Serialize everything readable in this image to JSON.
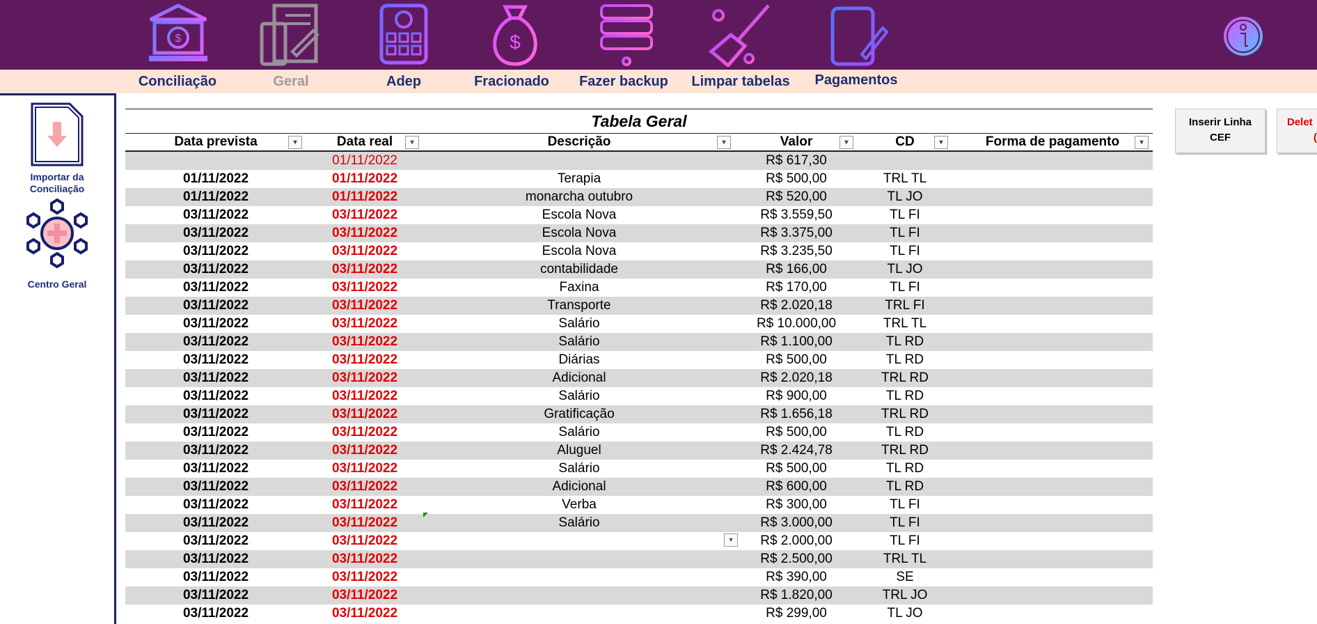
{
  "nav": [
    {
      "label": "Conciliação",
      "icon": "bank-icon"
    },
    {
      "label": "Geral",
      "icon": "calculator-document-icon"
    },
    {
      "label": "Adep",
      "icon": "bitcoin-calculator-icon"
    },
    {
      "label": "Fracionado",
      "icon": "money-bag-icon"
    },
    {
      "label": "Fazer backup",
      "icon": "server-backup-icon"
    },
    {
      "label": "Limpar tabelas",
      "icon": "broom-icon"
    },
    {
      "label": "Pagamentos",
      "icon": "edit-document-icon"
    }
  ],
  "sidebar": {
    "import_label_1": "Importar da",
    "import_label_2": "Conciliação",
    "center_label": "Centro Geral"
  },
  "table": {
    "title": "Tabela Geral",
    "columns": [
      "Data prevista",
      "Data real",
      "Descrição",
      "Valor",
      "CD",
      "Forma de pagamento"
    ],
    "rows": [
      {
        "dp": "",
        "dr": "01/11/2022",
        "desc": "",
        "valor": "R$ 617,30",
        "cd": "",
        "fp": ""
      },
      {
        "dp": "01/11/2022",
        "dr": "01/11/2022",
        "desc": "Terapia",
        "valor": "R$ 500,00",
        "cd": "TRL TL",
        "fp": ""
      },
      {
        "dp": "01/11/2022",
        "dr": "01/11/2022",
        "desc": "monarcha outubro",
        "valor": "R$ 520,00",
        "cd": "TL JO",
        "fp": ""
      },
      {
        "dp": "03/11/2022",
        "dr": "03/11/2022",
        "desc": "Escola Nova",
        "valor": "R$ 3.559,50",
        "cd": "TL FI",
        "fp": ""
      },
      {
        "dp": "03/11/2022",
        "dr": "03/11/2022",
        "desc": "Escola Nova",
        "valor": "R$ 3.375,00",
        "cd": "TL FI",
        "fp": ""
      },
      {
        "dp": "03/11/2022",
        "dr": "03/11/2022",
        "desc": "Escola Nova",
        "valor": "R$ 3.235,50",
        "cd": "TL FI",
        "fp": ""
      },
      {
        "dp": "03/11/2022",
        "dr": "03/11/2022",
        "desc": "contabilidade",
        "valor": "R$ 166,00",
        "cd": "TL JO",
        "fp": ""
      },
      {
        "dp": "03/11/2022",
        "dr": "03/11/2022",
        "desc": "Faxina",
        "valor": "R$ 170,00",
        "cd": "TL FI",
        "fp": ""
      },
      {
        "dp": "03/11/2022",
        "dr": "03/11/2022",
        "desc": "Transporte",
        "valor": "R$ 2.020,18",
        "cd": "TRL FI",
        "fp": ""
      },
      {
        "dp": "03/11/2022",
        "dr": "03/11/2022",
        "desc": "Salário",
        "valor": "R$ 10.000,00",
        "cd": "TRL TL",
        "fp": ""
      },
      {
        "dp": "03/11/2022",
        "dr": "03/11/2022",
        "desc": "Salário",
        "valor": "R$ 1.100,00",
        "cd": "TL RD",
        "fp": ""
      },
      {
        "dp": "03/11/2022",
        "dr": "03/11/2022",
        "desc": "Diárias",
        "valor": "R$ 500,00",
        "cd": "TL RD",
        "fp": ""
      },
      {
        "dp": "03/11/2022",
        "dr": "03/11/2022",
        "desc": "Adicional",
        "valor": "R$ 2.020,18",
        "cd": "TRL RD",
        "fp": ""
      },
      {
        "dp": "03/11/2022",
        "dr": "03/11/2022",
        "desc": "Salário",
        "valor": "R$ 900,00",
        "cd": "TL RD",
        "fp": ""
      },
      {
        "dp": "03/11/2022",
        "dr": "03/11/2022",
        "desc": "Gratificação",
        "valor": "R$ 1.656,18",
        "cd": "TRL RD",
        "fp": ""
      },
      {
        "dp": "03/11/2022",
        "dr": "03/11/2022",
        "desc": "Salário",
        "valor": "R$ 500,00",
        "cd": "TL RD",
        "fp": ""
      },
      {
        "dp": "03/11/2022",
        "dr": "03/11/2022",
        "desc": "Aluguel",
        "valor": "R$ 2.424,78",
        "cd": "TRL RD",
        "fp": ""
      },
      {
        "dp": "03/11/2022",
        "dr": "03/11/2022",
        "desc": "Salário",
        "valor": "R$ 500,00",
        "cd": "TL RD",
        "fp": ""
      },
      {
        "dp": "03/11/2022",
        "dr": "03/11/2022",
        "desc": "Adicional",
        "valor": "R$ 600,00",
        "cd": "TL RD",
        "fp": ""
      },
      {
        "dp": "03/11/2022",
        "dr": "03/11/2022",
        "desc": "Verba",
        "valor": "R$ 300,00",
        "cd": "TL FI",
        "fp": ""
      },
      {
        "dp": "03/11/2022",
        "dr": "03/11/2022",
        "desc": "Salário",
        "valor": "R$ 3.000,00",
        "cd": "TL FI",
        "fp": ""
      },
      {
        "dp": "03/11/2022",
        "dr": "03/11/2022",
        "desc": "",
        "valor": "R$ 2.000,00",
        "cd": "TL FI",
        "fp": ""
      },
      {
        "dp": "03/11/2022",
        "dr": "03/11/2022",
        "desc": "",
        "valor": "R$ 2.500,00",
        "cd": "TRL TL",
        "fp": ""
      },
      {
        "dp": "03/11/2022",
        "dr": "03/11/2022",
        "desc": "",
        "valor": "R$ 390,00",
        "cd": "SE",
        "fp": ""
      },
      {
        "dp": "03/11/2022",
        "dr": "03/11/2022",
        "desc": "",
        "valor": "R$ 1.820,00",
        "cd": "TRL JO",
        "fp": ""
      },
      {
        "dp": "03/11/2022",
        "dr": "03/11/2022",
        "desc": "",
        "valor": "R$ 299,00",
        "cd": "TL JO",
        "fp": ""
      }
    ]
  },
  "buttons": {
    "insert_line_1": "Inserir Linha",
    "insert_line_2": "CEF",
    "delete_partial_1": "Delet",
    "delete_partial_2": "("
  },
  "colors": {
    "banner": "#5f1a5e",
    "label_bar": "#fde4d6",
    "accent_red": "#e00000",
    "nav_text": "#1e2d73"
  }
}
